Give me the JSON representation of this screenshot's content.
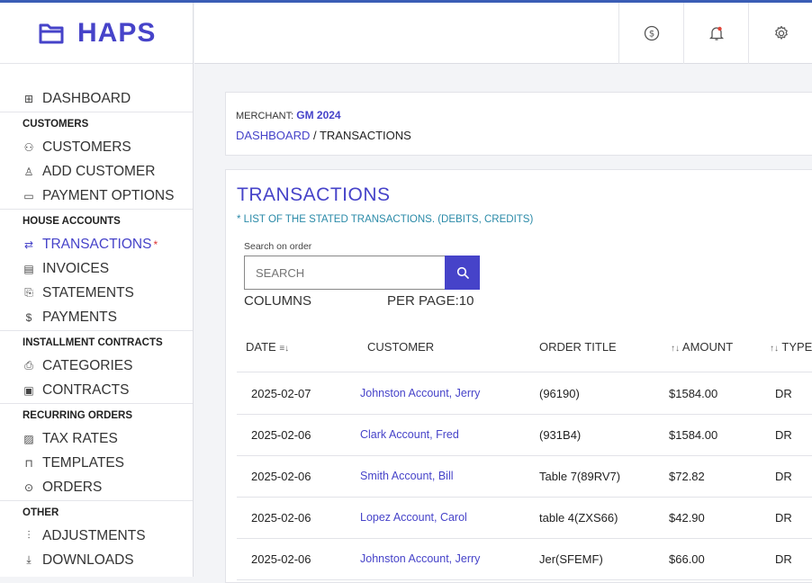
{
  "brand": {
    "name": "HAPS",
    "color": "#4643c9"
  },
  "topbar": {
    "icons": [
      "dollar-circle-icon",
      "bell-icon",
      "gear-icon"
    ]
  },
  "sidebar": {
    "dashboard": {
      "label": "DASHBOARD",
      "icon": "grid-icon"
    },
    "sections": [
      {
        "title": "CUSTOMERS",
        "items": [
          {
            "label": "CUSTOMERS",
            "icon": "users-icon"
          },
          {
            "label": "ADD CUSTOMER",
            "icon": "add-user-icon"
          },
          {
            "label": "PAYMENT OPTIONS",
            "icon": "card-icon"
          }
        ]
      },
      {
        "title": "HOUSE ACCOUNTS",
        "items": [
          {
            "label": "TRANSACTIONS",
            "icon": "swap-icon",
            "active": true,
            "marker": "*"
          },
          {
            "label": "INVOICES",
            "icon": "file-icon"
          },
          {
            "label": "STATEMENTS",
            "icon": "clipboard-icon"
          },
          {
            "label": "PAYMENTS",
            "icon": "dollar-icon"
          }
        ]
      },
      {
        "title": "INSTALLMENT CONTRACTS",
        "items": [
          {
            "label": "CATEGORIES",
            "icon": "printer-icon"
          },
          {
            "label": "CONTRACTS",
            "icon": "contract-icon"
          }
        ]
      },
      {
        "title": "RECURRING ORDERS",
        "items": [
          {
            "label": "TAX RATES",
            "icon": "tax-icon"
          },
          {
            "label": "TEMPLATES",
            "icon": "bookmark-icon"
          },
          {
            "label": "ORDERS",
            "icon": "check-circle-icon"
          }
        ]
      },
      {
        "title": "OTHER",
        "items": [
          {
            "label": "ADJUSTMENTS",
            "icon": "sliders-icon"
          },
          {
            "label": "DOWNLOADS",
            "icon": "download-icon"
          }
        ]
      }
    ]
  },
  "header": {
    "merchant_label": "MERCHANT:",
    "merchant_name": "GM 2024",
    "breadcrumb_link": "DASHBOARD",
    "breadcrumb_sep": " / ",
    "breadcrumb_current": "TRANSACTIONS"
  },
  "main": {
    "title": "TRANSACTIONS",
    "subtitle": "* LIST OF THE STATED TRANSACTIONS. (DEBITS, CREDITS)",
    "search_label": "Search on order",
    "search_placeholder": "SEARCH",
    "columns_label": "COLUMNS",
    "per_page_label": "PER PAGE:10"
  },
  "table": {
    "headers": [
      {
        "label": "DATE",
        "sort": "≡↓",
        "sort_pos": "after"
      },
      {
        "label": "CUSTOMER"
      },
      {
        "label": "ORDER TITLE"
      },
      {
        "label": "AMOUNT",
        "sort": "↑↓",
        "sort_pos": "before"
      },
      {
        "label": "TYPE",
        "sort": "↑↓",
        "sort_pos": "before"
      }
    ],
    "rows": [
      {
        "date": "2025-02-07",
        "customer": "Johnston Account, Jerry",
        "order": "(96190)",
        "amount": "$1584.00",
        "type": "DR"
      },
      {
        "date": "2025-02-06",
        "customer": "Clark Account, Fred",
        "order": "(931B4)",
        "amount": "$1584.00",
        "type": "DR"
      },
      {
        "date": "2025-02-06",
        "customer": "Smith Account, Bill",
        "order": "Table 7(89RV7)",
        "amount": "$72.82",
        "type": "DR"
      },
      {
        "date": "2025-02-06",
        "customer": "Lopez Account, Carol",
        "order": "table 4(ZXS66)",
        "amount": "$42.90",
        "type": "DR"
      },
      {
        "date": "2025-02-06",
        "customer": "Johnston Account, Jerry",
        "order": "Jer(SFEMF)",
        "amount": "$66.00",
        "type": "DR"
      }
    ]
  }
}
